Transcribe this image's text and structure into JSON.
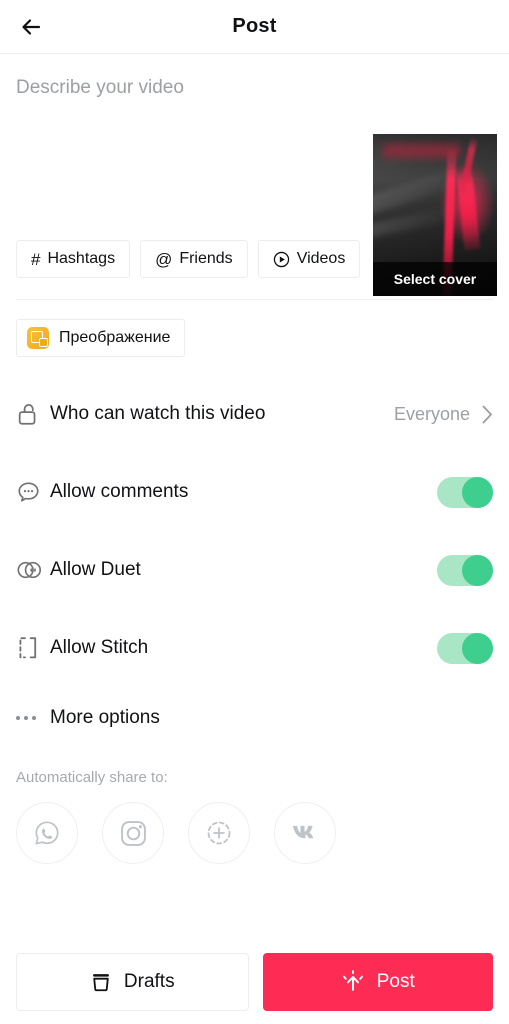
{
  "header": {
    "title": "Post",
    "back_icon": "arrow-left-icon"
  },
  "describe": {
    "placeholder": "Describe your video",
    "value": ""
  },
  "cover": {
    "select_cover_label": "Select cover"
  },
  "chips": [
    {
      "glyph": "#",
      "label": "Hashtags",
      "icon": "hashtag-icon"
    },
    {
      "glyph": "@",
      "label": "Friends",
      "icon": "at-mention-icon"
    },
    {
      "glyph": "▷",
      "label": "Videos",
      "icon": "play-circle-icon"
    }
  ],
  "effect": {
    "label": "Преображение",
    "icon": "video-effect-icon"
  },
  "settings": {
    "privacy": {
      "label": "Who can watch this video",
      "value": "Everyone",
      "icon": "unlock-icon"
    },
    "toggles": [
      {
        "label": "Allow comments",
        "icon": "comment-bubble-icon",
        "state": "on"
      },
      {
        "label": "Allow Duet",
        "icon": "duet-icon",
        "state": "on"
      },
      {
        "label": "Allow Stitch",
        "icon": "stitch-icon",
        "state": "on"
      }
    ],
    "more_options": {
      "label": "More options",
      "icon": "three-dots-icon"
    }
  },
  "share": {
    "label": "Automatically share to:",
    "targets": [
      {
        "name": "whatsapp-icon"
      },
      {
        "name": "instagram-icon"
      },
      {
        "name": "instagram-story-icon"
      },
      {
        "name": "vk-icon"
      }
    ]
  },
  "footer": {
    "drafts_label": "Drafts",
    "drafts_icon": "drafts-box-icon",
    "post_label": "Post",
    "post_icon": "upload-arrow-icon"
  },
  "colors": {
    "accent_red": "#fe2c55",
    "toggle_track": "#a8e6c6",
    "toggle_knob": "#3ecf8e",
    "effect_orange": "#f1a81c",
    "text_primary": "#111214",
    "text_muted": "#9c9fa4"
  }
}
